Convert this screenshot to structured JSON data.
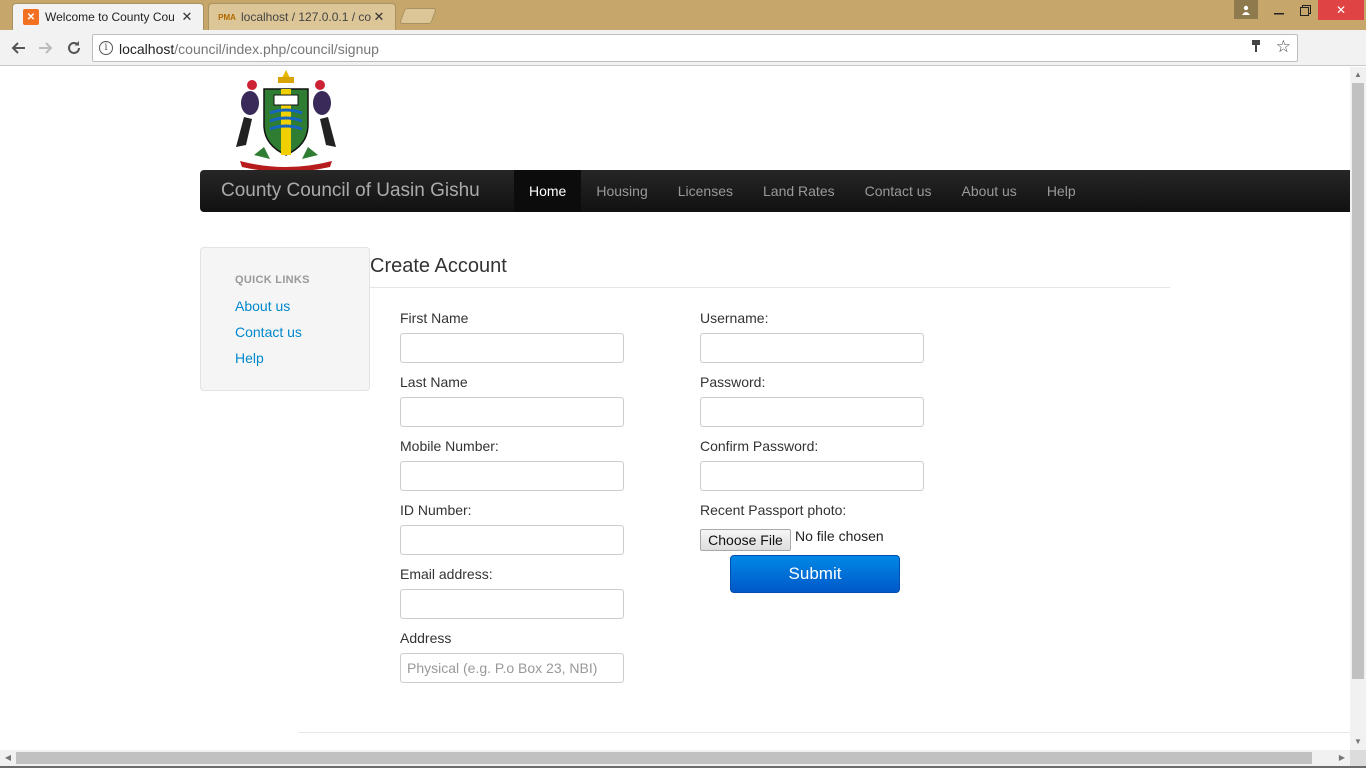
{
  "browser": {
    "tabs": [
      {
        "title": "Welcome to County Cou",
        "active": true,
        "icon": "xampp-icon"
      },
      {
        "title": "localhost / 127.0.0.1 / co",
        "active": false,
        "icon": "phpmyadmin-icon",
        "icon_text": "PMA"
      }
    ],
    "url_host": "localhost",
    "url_path": "/council/index.php/council/signup"
  },
  "site": {
    "brand": "County Council of Uasin Gishu",
    "nav": [
      {
        "label": "Home",
        "active": true
      },
      {
        "label": "Housing",
        "active": false
      },
      {
        "label": "Licenses",
        "active": false
      },
      {
        "label": "Land Rates",
        "active": false
      },
      {
        "label": "Contact us",
        "active": false
      },
      {
        "label": "About us",
        "active": false
      },
      {
        "label": "Help",
        "active": false
      }
    ]
  },
  "quick_links": {
    "header": "QUICK LINKS",
    "items": [
      "About us",
      "Contact us",
      "Help"
    ]
  },
  "form": {
    "title": "Create Account",
    "left": [
      {
        "label": "First Name",
        "value": "",
        "placeholder": ""
      },
      {
        "label": "Last Name",
        "value": "",
        "placeholder": ""
      },
      {
        "label": "Mobile Number:",
        "value": "",
        "placeholder": ""
      },
      {
        "label": "ID Number:",
        "value": "",
        "placeholder": ""
      },
      {
        "label": "Email address:",
        "value": "",
        "placeholder": ""
      },
      {
        "label": "Address",
        "value": "",
        "placeholder": "Physical (e.g. P.o Box 23, NBI)"
      }
    ],
    "right": [
      {
        "label": "Username:",
        "value": "",
        "placeholder": ""
      },
      {
        "label": "Password:",
        "value": "",
        "placeholder": ""
      },
      {
        "label": "Confirm Password:",
        "value": "",
        "placeholder": ""
      }
    ],
    "photo_label": "Recent Passport photo:",
    "file_button": "Choose File",
    "file_status": "No file chosen",
    "submit": "Submit"
  },
  "colors": {
    "titlebar": "#c6a66b",
    "navbar": "#1b1b1b",
    "link": "#0088cc",
    "submit": "#0070d8"
  }
}
